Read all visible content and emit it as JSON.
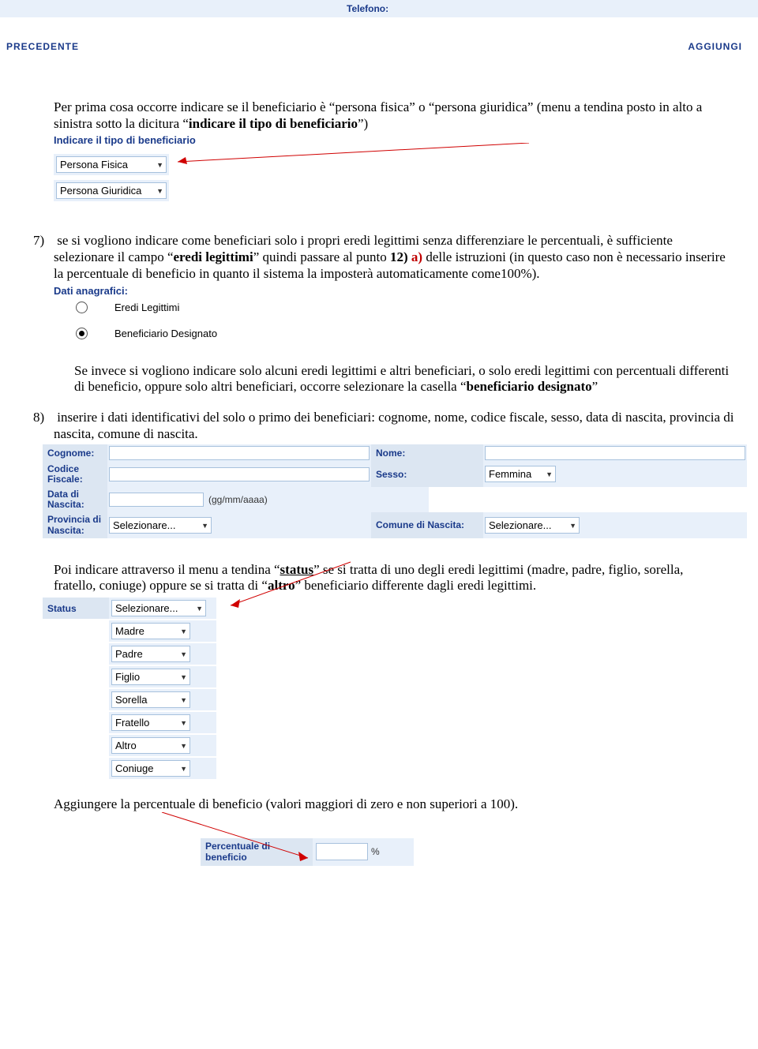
{
  "top": {
    "telefono_label": "Telefono:"
  },
  "cmd": {
    "prev": "PRECEDENTE",
    "add": "AGGIUNGI"
  },
  "para1": "Per prima cosa occorre indicare se il beneficiario è “persona fisica” o “persona giuridica” (menu a tendina posto in alto a sinistra sotto la dicitura “",
  "para1_bold": "indicare il tipo di beneficiario",
  "para1_end": "”)",
  "tipo_benef_label": "Indicare il tipo di beneficiario",
  "tipo_options": {
    "pf": "Persona Fisica",
    "pg": "Persona Giuridica"
  },
  "item7": {
    "num": "7)",
    "t1": "se si vogliono indicare come beneficiari solo i propri eredi legittimi senza differenziare le percentuali, è sufficiente selezionare il campo “",
    "b1": "eredi legittimi",
    "t2": "” quindi passare al punto ",
    "b2": "12) ",
    "a": "a)",
    "t3": " delle istruzioni (in questo caso non è necessario inserire la percentuale di beneficio in quanto il sistema la imposterà automaticamente come100%)."
  },
  "dati_anag_label": "Dati anagrafici:",
  "anag_options": {
    "el": "Eredi Legittimi",
    "bd": "Beneficiario Designato"
  },
  "para7b": {
    "t1": "Se invece si vogliono indicare solo alcuni eredi legittimi e altri beneficiari, o solo eredi legittimi con percentuali differenti di beneficio, oppure solo altri beneficiari, occorre selezionare la casella “",
    "b1": "beneficiario designato",
    "t2": "”"
  },
  "item8": {
    "num": "8)",
    "text": " inserire i dati identificativi del solo o primo dei beneficiari: cognome, nome, codice fiscale, sesso, data di nascita, provincia di nascita, comune di nascita."
  },
  "form": {
    "cognome": "Cognome:",
    "nome": "Nome:",
    "cf": "Codice Fiscale:",
    "sesso": "Sesso:",
    "sesso_val": "Femmina",
    "dn": "Data di Nascita:",
    "dn_hint": "(gg/mm/aaaa)",
    "pn": "Provincia di Nascita:",
    "cn": "Comune di Nascita:",
    "selez": "Selezionare..."
  },
  "para_status": {
    "t1": "Poi indicare attraverso il menu a tendina “",
    "u1": "status",
    "t2": "” se si tratta di uno degli eredi legittimi (madre, padre, figlio, sorella, fratello, coniuge) oppure se si tratta di “",
    "b1": "altro",
    "t3": "” beneficiario differente dagli eredi legittimi."
  },
  "status": {
    "label": "Status",
    "selez": "Selezionare...",
    "opts": [
      "Madre",
      "Padre",
      "Figlio",
      "Sorella",
      "Fratello",
      "Altro",
      "Coniuge"
    ]
  },
  "para_perc": "Aggiungere la percentuale di beneficio (valori maggiori di zero e non superiori a 100).",
  "perc": {
    "label": "Percentuale di beneficio",
    "unit": "%"
  }
}
